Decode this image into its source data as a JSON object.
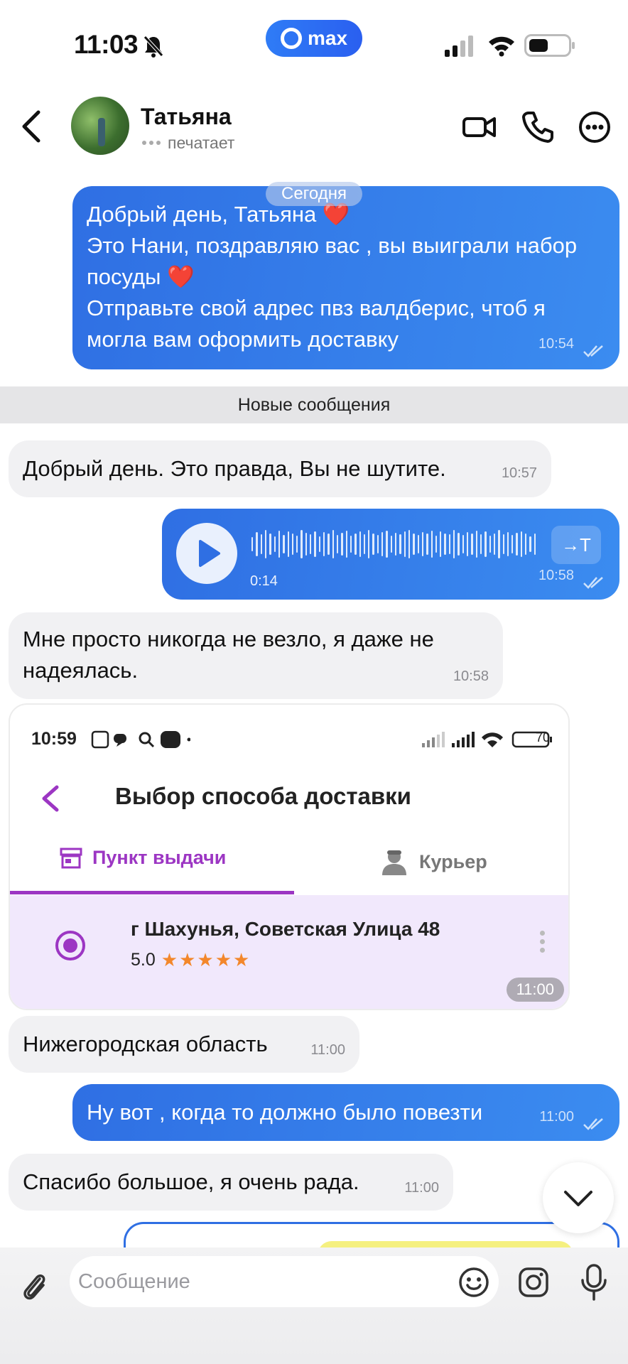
{
  "status_bar": {
    "time": "11:03",
    "app_badge": "max"
  },
  "header": {
    "contact_name": "Татьяна",
    "status": "печатает"
  },
  "chat": {
    "date_chip": "Сегодня",
    "new_messages_divider": "Новые сообщения",
    "messages": [
      {
        "direction": "out",
        "text": "Добрый день, Татьяна ❤️\nЭто Нани, поздравляю вас , вы выиграли набор посуды ❤️\nОтправьте свой адрес пвз валдберис, чтоб я могла вам оформить доставку",
        "time": "10:54",
        "read": true
      },
      {
        "direction": "in",
        "text": "Добрый день. Это правда, Вы не шутите.",
        "time": "10:57"
      },
      {
        "direction": "out",
        "type": "voice",
        "duration": "0:14",
        "transcribe_label": "→T",
        "time": "10:58",
        "read": true
      },
      {
        "direction": "in",
        "text": "Мне просто никогда не везло, я даже не надеялась.",
        "time": "10:58"
      },
      {
        "direction": "in",
        "type": "image",
        "time": "11:00"
      },
      {
        "direction": "in",
        "text": "Нижегородская область",
        "time": "11:00"
      },
      {
        "direction": "out",
        "text": "Ну вот , когда то должно было повезти",
        "time": "11:00",
        "read": true
      },
      {
        "direction": "in",
        "text": "Спасибо большое, я очень рада.",
        "time": "11:00"
      }
    ]
  },
  "screenshot_image": {
    "status_time": "10:59",
    "battery": "70",
    "title": "Выбор способа доставки",
    "tab_pickup": "Пункт выдачи",
    "tab_courier": "Курьер",
    "address": "г Шахунья, Советская Улица 48",
    "rating": "5.0",
    "stars": "★★★★★",
    "accent_color": "#9c36c3"
  },
  "composer": {
    "placeholder": "Сообщение"
  },
  "colors": {
    "outgoing_bubble": "#2f6fe3",
    "incoming_bubble": "#f1f1f3"
  }
}
